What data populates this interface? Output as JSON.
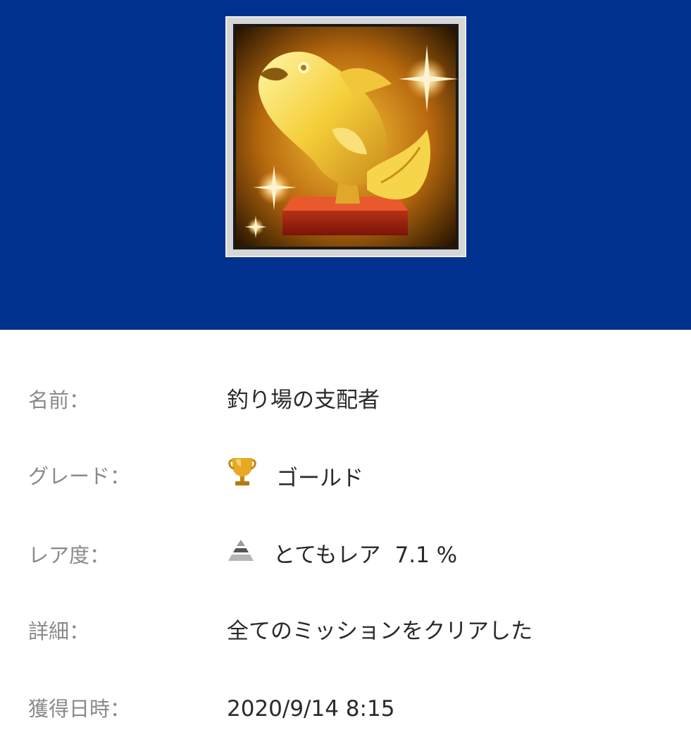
{
  "trophy_image": {
    "icon": "golden-fish-trophy-icon",
    "background": "#00318f"
  },
  "details": {
    "name": {
      "label": "名前：",
      "value": "釣り場の支配者"
    },
    "grade": {
      "label": "グレード：",
      "icon": "gold-trophy-cup-icon",
      "value": "ゴールド"
    },
    "rarity": {
      "label": "レア度：",
      "icon": "rarity-pyramid-icon",
      "value": "とてもレア",
      "percent": "7.1 %"
    },
    "description": {
      "label": "詳細：",
      "value": "全てのミッションをクリアした"
    },
    "earned": {
      "label": "獲得日時：",
      "value": "2020/9/14 8:15"
    }
  }
}
